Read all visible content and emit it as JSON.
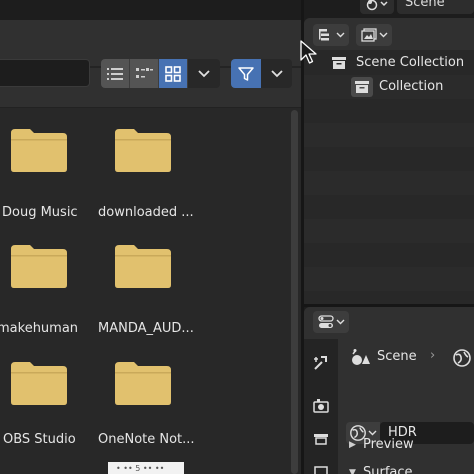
{
  "file_browser": {
    "path_value": "",
    "view_modes": [
      "vertical-list-icon",
      "horizontal-list-icon",
      "thumbnails-icon"
    ],
    "active_view": "thumbnails-icon",
    "files": [
      {
        "name": "Doug Music",
        "type": "folder"
      },
      {
        "name": "downloaded ...",
        "type": "folder"
      },
      {
        "name": "makehuman",
        "type": "folder"
      },
      {
        "name": "MANDA_AUD...",
        "type": "folder"
      },
      {
        "name": "OBS Studio",
        "type": "folder"
      },
      {
        "name": "OneNote Not...",
        "type": "folder"
      }
    ],
    "partial_thumb_text": "• •• 5 •• ••"
  },
  "topbar": {
    "scene_label": "Scene"
  },
  "outliner": {
    "rows": [
      {
        "label": "Scene Collection",
        "icon": "collection-box-icon"
      },
      {
        "label": "Collection",
        "icon": "collection-box-icon"
      }
    ]
  },
  "properties": {
    "breadcrumb": {
      "scene": "Scene",
      "sep": "›"
    },
    "world_name": "HDR",
    "panels": [
      {
        "label": "Preview",
        "expanded": false
      },
      {
        "label": "Surface",
        "expanded": true
      }
    ],
    "tabs": [
      "tool-icon",
      "render-icon",
      "output-icon",
      "view-layer-icon"
    ]
  },
  "colors": {
    "accent": "#4772b3",
    "folder": "#e1c16e",
    "panel": "#303030",
    "bg": "#282828"
  }
}
